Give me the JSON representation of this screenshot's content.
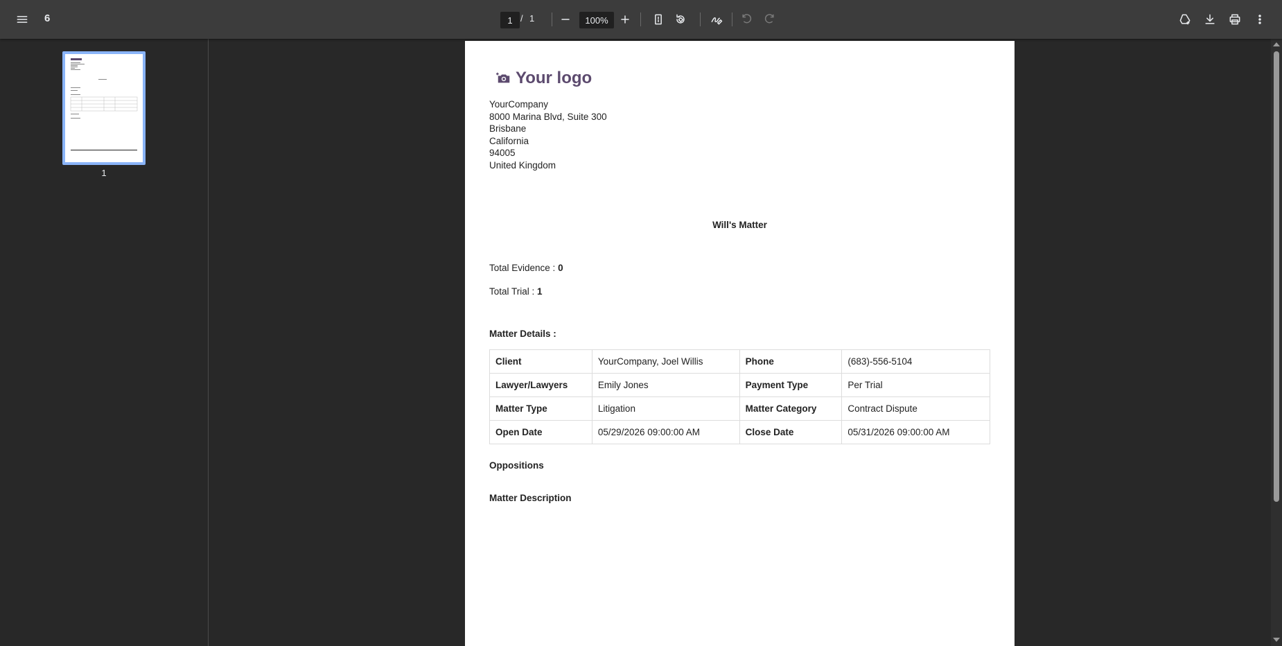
{
  "toolbar": {
    "title": "6",
    "page_current": "1",
    "page_sep": "/",
    "page_total": "1",
    "zoom": "100%"
  },
  "sidebar": {
    "thumbnail_label": "1"
  },
  "document": {
    "logo_text": "Your logo",
    "address": [
      "YourCompany",
      "8000 Marina Blvd, Suite 300",
      "Brisbane",
      "California",
      "94005",
      "United Kingdom"
    ],
    "matter_title": "Will's Matter",
    "total_evidence_label": "Total Evidence : ",
    "total_evidence_value": "0",
    "total_trial_label": "Total Trial : ",
    "total_trial_value": "1",
    "matter_details_heading": "Matter Details :",
    "details": [
      [
        "Client",
        "YourCompany, Joel Willis",
        "Phone",
        "(683)-556-5104"
      ],
      [
        "Lawyer/Lawyers",
        "Emily Jones",
        "Payment Type",
        "Per Trial"
      ],
      [
        "Matter Type",
        "Litigation",
        "Matter Category",
        "Contract Dispute"
      ],
      [
        "Open Date",
        "05/29/2026 09:00:00 AM",
        "Close Date",
        "05/31/2026 09:00:00 AM"
      ]
    ],
    "oppositions_heading": "Oppositions",
    "matter_description_heading": "Matter Description"
  },
  "colors": {
    "toolbar_bg": "#3c3c3c",
    "viewer_bg": "#282828",
    "thumb_border": "#8ab4f8",
    "logo": "#5c4a6e"
  }
}
